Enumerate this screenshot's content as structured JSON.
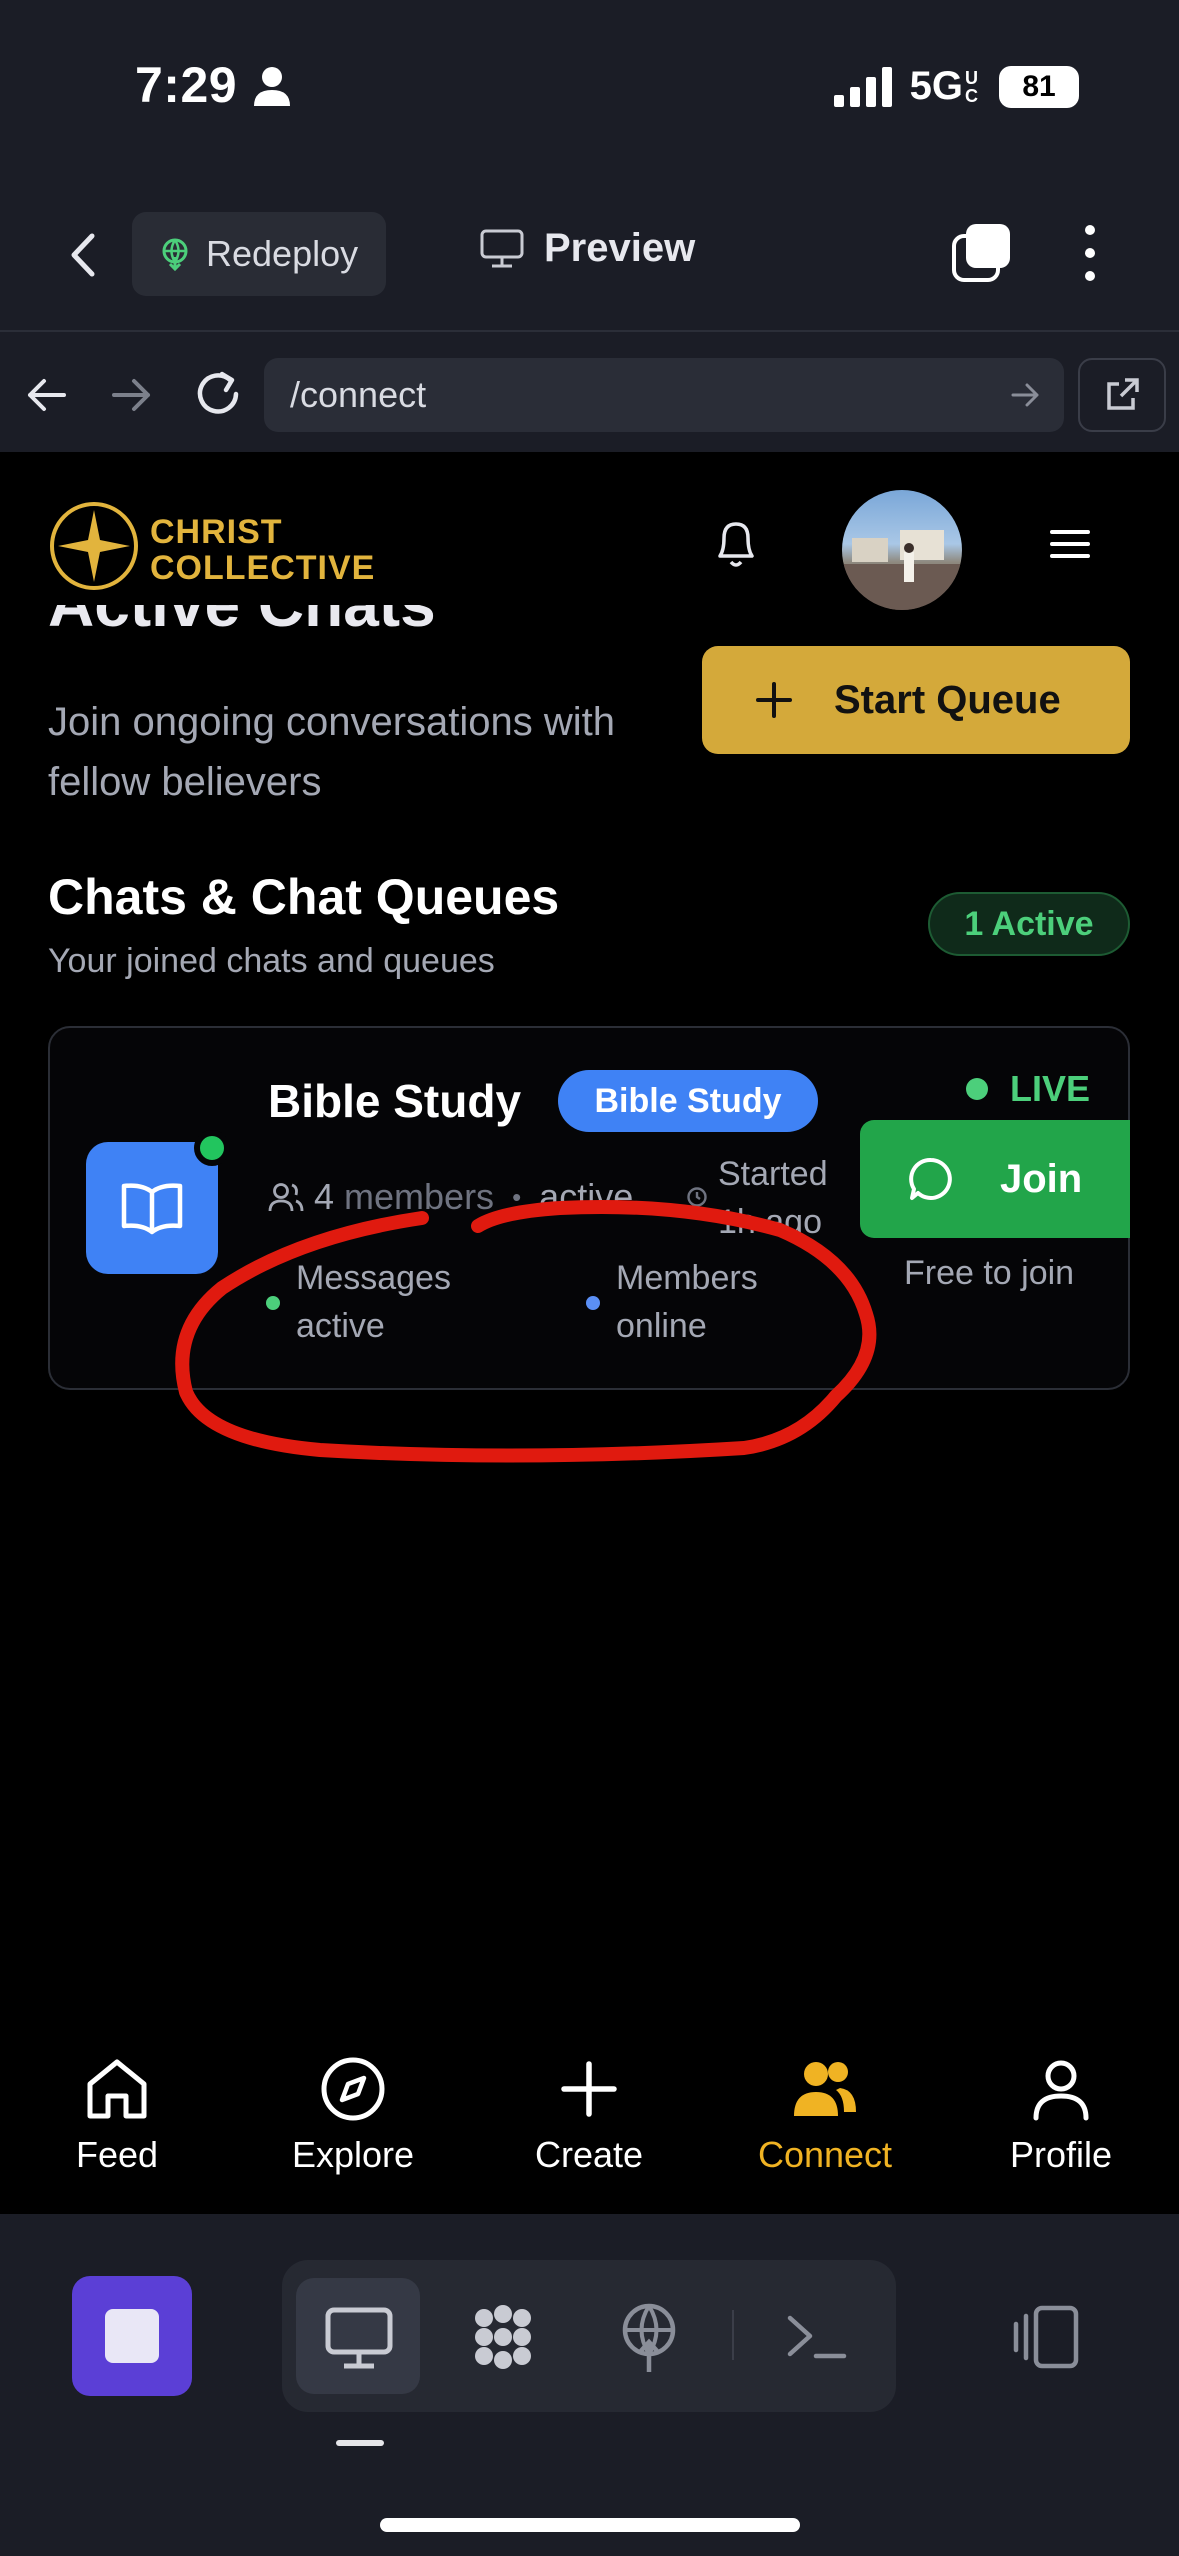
{
  "status_bar": {
    "time": "7:29",
    "network": "5G",
    "network_sub": "UC",
    "battery": "81"
  },
  "browser": {
    "redeploy_label": "Redeploy",
    "preview_label": "Preview",
    "url": "/connect"
  },
  "app": {
    "logo_line1": "CHRIST",
    "logo_line2": "COLLECTIVE",
    "hero_title": "Active Chats",
    "hero_subtitle": "Join ongoing conversations with fellow believers",
    "start_queue_label": "Start Queue",
    "section_title": "Chats & Chat Queues",
    "section_subtitle": "Your joined chats and queues",
    "active_badge": "1 Active",
    "card": {
      "title": "Bible Study",
      "tag": "Bible Study",
      "member_count": "4",
      "members_word": "members",
      "active_word": "active",
      "started_line1": "Started",
      "started_line2": "1h ago",
      "live_label": "LIVE",
      "join_label": "Join",
      "free_label": "Free to join",
      "stat1_line1": "Messages",
      "stat1_line2": "active",
      "stat2_line1": "Members",
      "stat2_line2": "online"
    }
  },
  "tabs": [
    {
      "label": "Feed",
      "icon": "home-icon"
    },
    {
      "label": "Explore",
      "icon": "compass-icon"
    },
    {
      "label": "Create",
      "icon": "plus-icon"
    },
    {
      "label": "Connect",
      "icon": "users-icon",
      "active": true
    },
    {
      "label": "Profile",
      "icon": "user-icon"
    }
  ],
  "colors": {
    "accent_gold": "#d4a93a",
    "tab_active": "#f0b323",
    "join_green": "#22a54a",
    "tag_blue": "#3f82f5",
    "annotation_red": "#e01a0f"
  }
}
